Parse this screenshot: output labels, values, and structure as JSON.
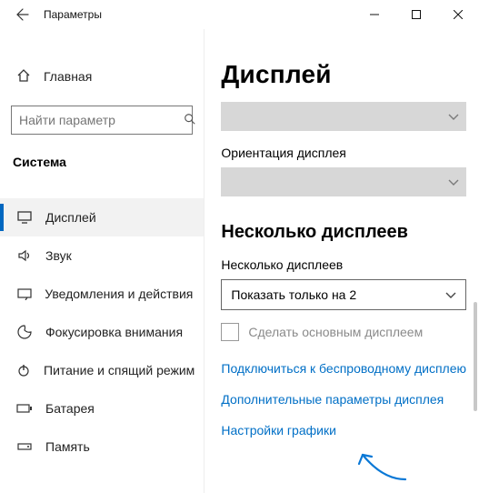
{
  "window": {
    "title": "Параметры"
  },
  "sidebar": {
    "home_label": "Главная",
    "search_placeholder": "Найти параметр",
    "group_label": "Система",
    "items": [
      {
        "label": "Дисплей"
      },
      {
        "label": "Звук"
      },
      {
        "label": "Уведомления и действия"
      },
      {
        "label": "Фокусировка внимания"
      },
      {
        "label": "Питание и спящий режим"
      },
      {
        "label": "Батарея"
      },
      {
        "label": "Память"
      }
    ]
  },
  "content": {
    "page_title": "Дисплей",
    "orientation_label": "Ориентация дисплея",
    "multi_section_title": "Несколько дисплеев",
    "multi_label": "Несколько дисплеев",
    "multi_dropdown_value": "Показать только на 2",
    "make_primary_label": "Сделать основным дисплеем",
    "links": {
      "wireless": "Подключиться к беспроводному дисплею",
      "advanced": "Дополнительные параметры дисплея",
      "graphics": "Настройки графики"
    }
  }
}
